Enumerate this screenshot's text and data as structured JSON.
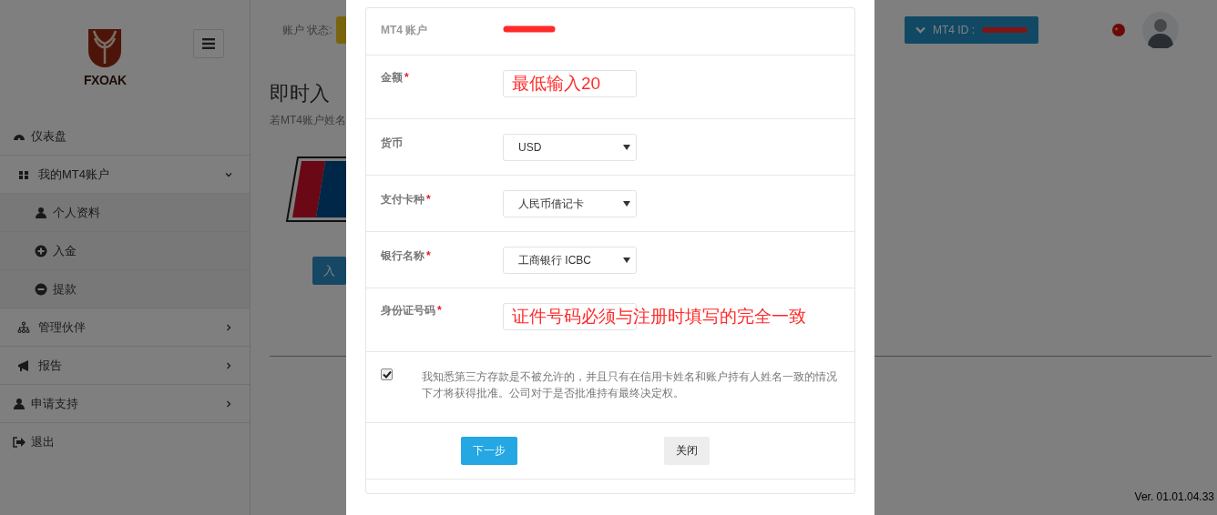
{
  "sidebar": {
    "logo_text": "FXOAK",
    "menu": [
      {
        "label": "仪表盘"
      },
      {
        "label": "我的MT4账户",
        "expanded": true,
        "children": [
          {
            "label": "个人资料"
          },
          {
            "label": "入金"
          },
          {
            "label": "提款"
          }
        ]
      },
      {
        "label": "管理伙伴",
        "expanded": false
      },
      {
        "label": "报告",
        "expanded": false
      },
      {
        "label": "申请支持",
        "expanded": false
      },
      {
        "label": "退出"
      }
    ]
  },
  "header": {
    "status_label": "账户 状态:",
    "mt4_id_label": "MT4 ID :",
    "mt4_id_redacted": true
  },
  "page": {
    "title": "即时入",
    "subtitle": "若MT4账户姓名",
    "button": "入"
  },
  "modal": {
    "rows": [
      {
        "kind": "static",
        "label": "MT4 账户",
        "redacted": true
      },
      {
        "kind": "input",
        "label": "金额",
        "required_mark": "*",
        "annotation": "最低输入20"
      },
      {
        "kind": "select",
        "label": "货币",
        "value": "USD"
      },
      {
        "kind": "select",
        "label": "支付卡种",
        "required_mark": "*",
        "value": "人民币借记卡"
      },
      {
        "kind": "select",
        "label": "银行名称",
        "required_mark": "*",
        "value": "工商银行 ICBC"
      },
      {
        "kind": "input",
        "label": "身份证号码",
        "required_mark": "*",
        "annotation": "证件号码必须与注册时填写的完全一致"
      }
    ],
    "agreement": {
      "checked": true,
      "text": "我知悉第三方存款是不被允许的，并且只有在信用卡姓名和账户持有人姓名一致的情况下才将获得批准。公司对于是否批准持有最终决定权。"
    },
    "buttons": [
      {
        "label": "下一步",
        "kind": "primary"
      },
      {
        "label": "关闭",
        "kind": "default"
      }
    ]
  },
  "version": "Ver. 01.01.04.33"
}
